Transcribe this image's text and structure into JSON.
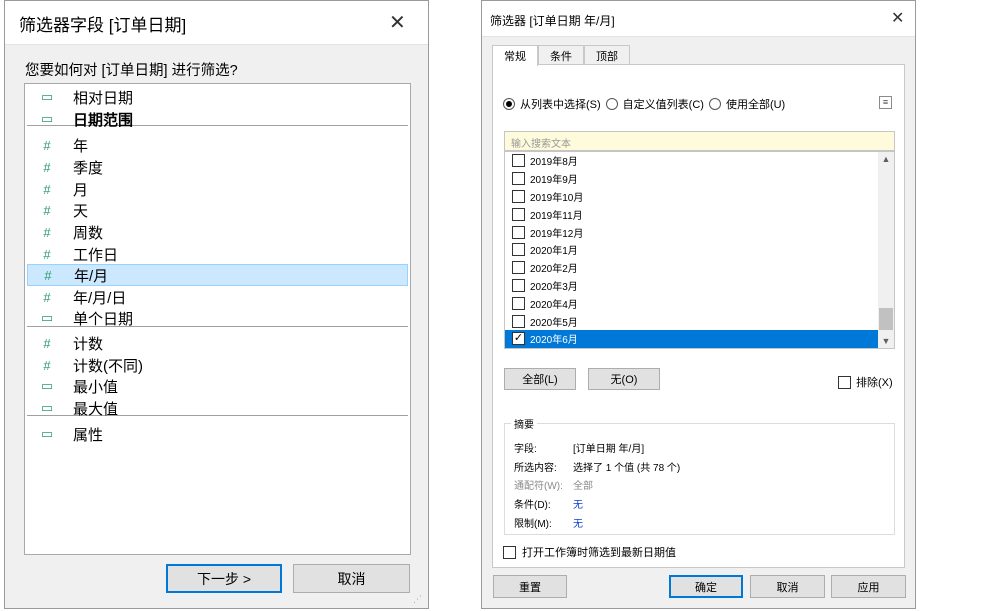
{
  "dialog1": {
    "title": "筛选器字段 [订单日期]",
    "close": "✕",
    "question": "您要如何对 [订单日期] 进行筛选?",
    "items": [
      {
        "label": "相对日期",
        "icon": "calendar-icon",
        "glyph": "▭"
      },
      {
        "label": "日期范围",
        "icon": "calendar-icon",
        "glyph": "▭",
        "bold": true
      },
      {
        "label": "年",
        "icon": "hash-icon",
        "glyph": "#"
      },
      {
        "label": "季度",
        "icon": "hash-icon",
        "glyph": "#"
      },
      {
        "label": "月",
        "icon": "hash-icon",
        "glyph": "#"
      },
      {
        "label": "天",
        "icon": "hash-icon",
        "glyph": "#"
      },
      {
        "label": "周数",
        "icon": "hash-icon",
        "glyph": "#"
      },
      {
        "label": "工作日",
        "icon": "hash-icon",
        "glyph": "#"
      },
      {
        "label": "年/月",
        "icon": "hash-icon",
        "glyph": "#",
        "selected": true
      },
      {
        "label": "年/月/日",
        "icon": "hash-icon",
        "glyph": "#"
      },
      {
        "label": "单个日期",
        "icon": "calendar-icon",
        "glyph": "▭"
      },
      {
        "label": "计数",
        "icon": "hash-icon",
        "glyph": "#"
      },
      {
        "label": "计数(不同)",
        "icon": "hash-icon",
        "glyph": "#"
      },
      {
        "label": "最小值",
        "icon": "calendar-icon",
        "glyph": "▭"
      },
      {
        "label": "最大值",
        "icon": "calendar-icon",
        "glyph": "▭"
      },
      {
        "label": "属性",
        "icon": "calendar-icon",
        "glyph": "▭"
      }
    ],
    "next_label": "下一步 >",
    "cancel_label": "取消"
  },
  "dialog2": {
    "title": "筛选器 [订单日期 年/月]",
    "close": "✕",
    "tabs": [
      "常规",
      "条件",
      "顶部"
    ],
    "active_tab": "常规",
    "radios": [
      {
        "label": "从列表中选择(S)",
        "checked": true
      },
      {
        "label": "自定义值列表(C)",
        "checked": false
      },
      {
        "label": "使用全部(U)",
        "checked": false
      }
    ],
    "search_placeholder": "输入搜索文本",
    "values": [
      {
        "label": "2019年8月",
        "checked": false
      },
      {
        "label": "2019年9月",
        "checked": false
      },
      {
        "label": "2019年10月",
        "checked": false
      },
      {
        "label": "2019年11月",
        "checked": false
      },
      {
        "label": "2019年12月",
        "checked": false
      },
      {
        "label": "2020年1月",
        "checked": false
      },
      {
        "label": "2020年2月",
        "checked": false
      },
      {
        "label": "2020年3月",
        "checked": false
      },
      {
        "label": "2020年4月",
        "checked": false
      },
      {
        "label": "2020年5月",
        "checked": false
      },
      {
        "label": "2020年6月",
        "checked": true,
        "selected": true
      }
    ],
    "all_label": "全部(L)",
    "none_label": "无(O)",
    "exclude_label": "排除(X)",
    "summary": {
      "title": "摘要",
      "field_key": "字段:",
      "field_val": "[订单日期 年/月]",
      "selection_key": "所选内容:",
      "selection_val": "选择了 1 个值 (共 78 个)",
      "wildcard_key": "通配符(W):",
      "wildcard_val": "全部",
      "condition_key": "条件(D):",
      "condition_val": "无",
      "limit_key": "限制(M):",
      "limit_val": "无"
    },
    "open_wb_label": "打开工作簿时筛选到最新日期值",
    "reset_label": "重置",
    "ok_label": "确定",
    "cancel_label": "取消",
    "apply_label": "应用"
  }
}
